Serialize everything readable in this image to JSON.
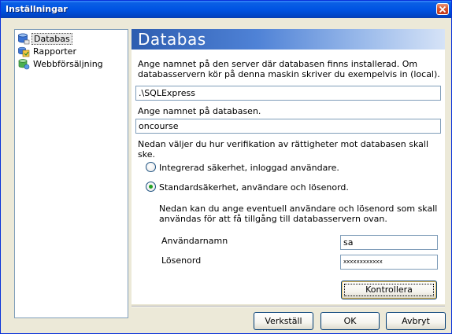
{
  "window": {
    "title": "Inställningar"
  },
  "sidebar": {
    "items": [
      {
        "label": "Databas",
        "icon": "database-icon",
        "selected": true
      },
      {
        "label": "Rapporter",
        "icon": "reports-icon",
        "selected": false
      },
      {
        "label": "Webbförsäljning",
        "icon": "web-sales-icon",
        "selected": false
      }
    ]
  },
  "panel": {
    "title": "Databas",
    "server_instruction": "Ange namnet på den server där databasen finns installerad. Om databasservern kör på denna maskin skriver du exempelvis in (local).",
    "server_value": ".\\SQLExpress",
    "database_instruction": "Ange namnet på databasen.",
    "database_value": "oncourse",
    "auth_instruction": "Nedan väljer du hur verifikation av rättigheter mot databasen skall ske.",
    "auth_options": [
      {
        "label": "Integrerad säkerhet, inloggad användare.",
        "checked": false
      },
      {
        "label": "Standardsäkerhet, användare och lösenord.",
        "checked": true
      }
    ],
    "credentials_instruction": "Nedan kan du ange eventuell användare och lösenord som skall användas för att få tillgång till databasservern ovan.",
    "username_label": "Användarnamn",
    "username_value": "sa",
    "password_label": "Lösenord",
    "password_value": "xxxxxxxxxxxx",
    "check_button": "Kontrollera"
  },
  "footer": {
    "apply_button": "Verkställ",
    "ok_button": "OK",
    "cancel_button": "Avbryt"
  },
  "colors": {
    "accent": "#0054E3",
    "radio_checked": "#21A121",
    "header_gradient_start": "#2D5DB0"
  }
}
